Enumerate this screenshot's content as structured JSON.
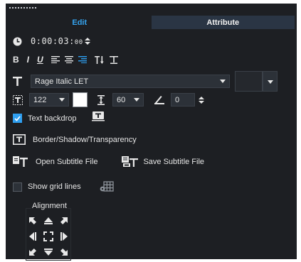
{
  "tabs": {
    "edit": "Edit",
    "attribute": "Attribute"
  },
  "time": {
    "main": "0:00:03:",
    "frames": "00"
  },
  "format_buttons": [
    "B",
    "I",
    "U"
  ],
  "font": {
    "name": "Rage Italic LET"
  },
  "size": {
    "font_size": "122",
    "line_spacing": "60",
    "angle": "0"
  },
  "options": {
    "text_backdrop": "Text backdrop",
    "border_shadow": "Border/Shadow/Transparency",
    "open_subtitle": "Open Subtitle File",
    "save_subtitle": "Save Subtitle File",
    "show_grid": "Show grid lines"
  },
  "state": {
    "text_backdrop_checked": true,
    "show_grid_checked": false
  },
  "alignment": {
    "title": "Alignment"
  },
  "colors": {
    "panel_bg": "#1d1f23",
    "accent": "#2ea1f2",
    "tab_inactive": "#2a3544",
    "text_color_swatch": "#ffffff"
  }
}
